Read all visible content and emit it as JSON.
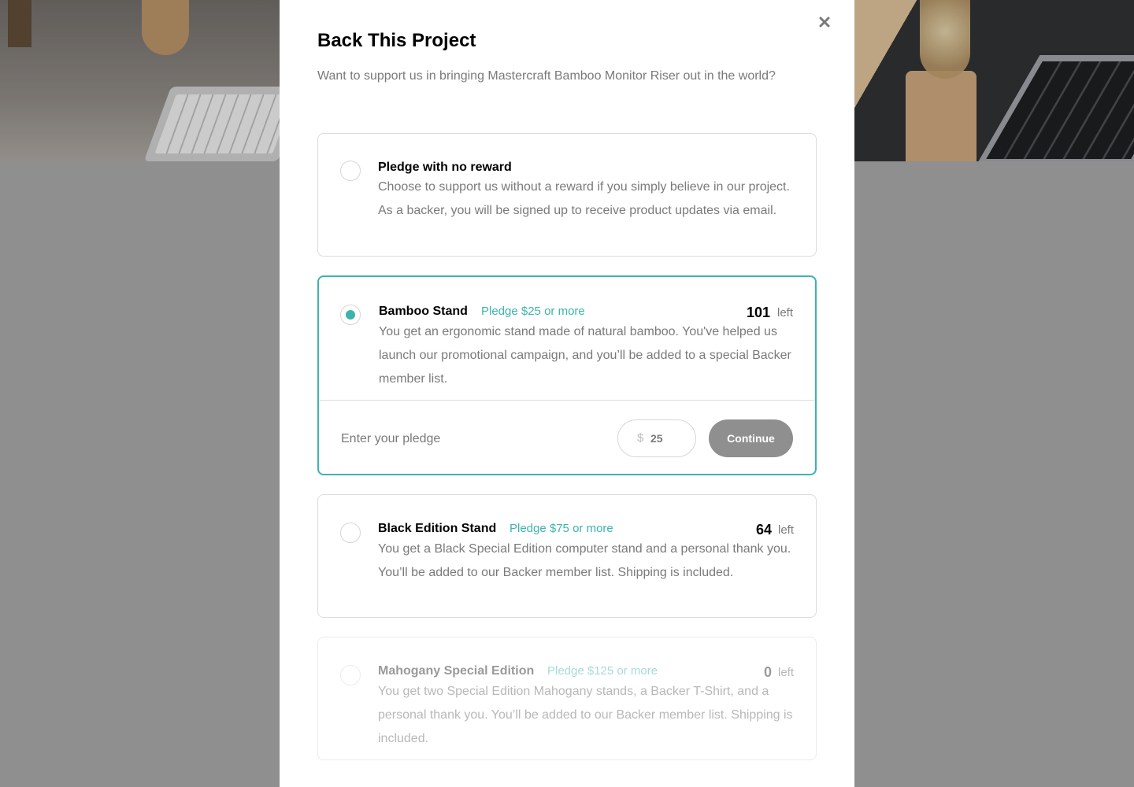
{
  "modal": {
    "title": "Back This Project",
    "description": "Want to support us in bringing Mastercraft Bamboo Monitor Riser out in the world?",
    "close_icon": "close-icon"
  },
  "rewards": [
    {
      "title": "Pledge with no reward",
      "body": "Choose to support us without a reward if you simply believe in our project. As a backer, you will be signed up to receive product updates via email.",
      "selected": false
    },
    {
      "title": "Bamboo Stand",
      "pledge": "Pledge $25 or more",
      "left_count": "101",
      "left_label": "left",
      "body": "You get an ergonomic stand made of natural bamboo. You've helped us launch our promotional campaign, and you’ll be added to a special Backer member list.",
      "selected": true,
      "enter_label": "Enter your pledge",
      "currency": "$",
      "amount": "25",
      "continue_label": "Continue"
    },
    {
      "title": "Black Edition Stand",
      "pledge": "Pledge $75 or more",
      "left_count": "64",
      "left_label": "left",
      "body": "You get a Black Special Edition computer stand and a personal thank you. You’ll be added to our Backer member list. Shipping is included.",
      "selected": false
    },
    {
      "title": "Mahogany Special Edition",
      "pledge": "Pledge $125 or more",
      "left_count": "0",
      "left_label": "left",
      "body": "You get two Special Edition Mahogany stands, a Backer T-Shirt, and a personal thank you. You’ll be added to our Backer member list. Shipping is included.",
      "selected": false,
      "disabled": true
    }
  ],
  "colors": {
    "accent": "#3cb4ac",
    "overlay": "#8f8f8f",
    "button_inactive": "#8f8f8f"
  }
}
